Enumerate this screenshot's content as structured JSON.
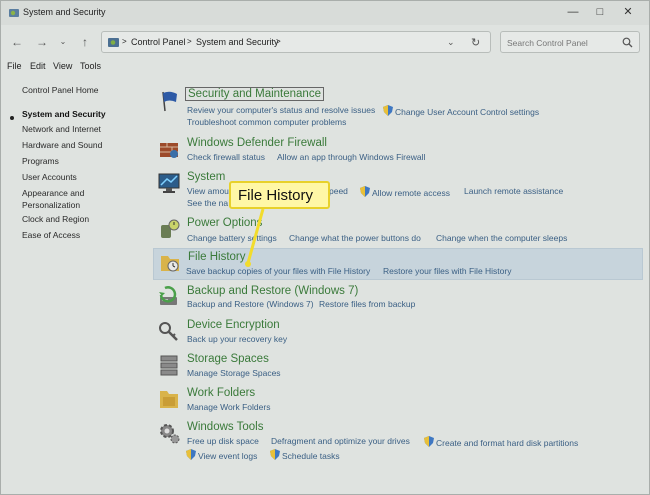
{
  "window": {
    "title": "System and Security"
  },
  "address": {
    "crumbs": [
      "Control Panel",
      "System and Security"
    ],
    "separator": ">",
    "search_placeholder": "Search Control Panel"
  },
  "menu": [
    "File",
    "Edit",
    "View",
    "Tools"
  ],
  "sidebar": {
    "items": [
      {
        "label": "Control Panel Home"
      },
      {
        "label": "System and Security"
      },
      {
        "label": "Network and Internet"
      },
      {
        "label": "Hardware and Sound"
      },
      {
        "label": "Programs"
      },
      {
        "label": "User Accounts"
      },
      {
        "label": "Appearance and Personalization"
      },
      {
        "label": "Clock and Region"
      },
      {
        "label": "Ease of Access"
      }
    ]
  },
  "categories": [
    {
      "title": "Security and Maintenance",
      "icon": "security-flag-icon",
      "links": [
        "Review your computer's status and resolve issues",
        "Change User Account Control settings",
        "Troubleshoot common computer problems"
      ]
    },
    {
      "title": "Windows Defender Firewall",
      "icon": "firewall-icon",
      "links": [
        "Check firewall status",
        "Allow an app through Windows Firewall"
      ]
    },
    {
      "title": "System",
      "icon": "monitor-icon",
      "links": [
        "View amou",
        "peed",
        "Allow remote access",
        "Launch remote assistance",
        "See the na"
      ]
    },
    {
      "title": "Power Options",
      "icon": "power-plug-icon",
      "links": [
        "Change battery settings",
        "Change what the power buttons do",
        "Change when the computer sleeps"
      ]
    },
    {
      "title": "File History",
      "icon": "file-history-icon",
      "links": [
        "Save backup copies of your files with File History",
        "Restore your files with File History"
      ]
    },
    {
      "title": "Backup and Restore (Windows 7)",
      "icon": "backup-icon",
      "links": [
        "Backup and Restore (Windows 7)",
        "Restore files from backup"
      ]
    },
    {
      "title": "Device Encryption",
      "icon": "key-icon",
      "links": [
        "Back up your recovery key"
      ]
    },
    {
      "title": "Storage Spaces",
      "icon": "storage-icon",
      "links": [
        "Manage Storage Spaces"
      ]
    },
    {
      "title": "Work Folders",
      "icon": "folder-icon",
      "links": [
        "Manage Work Folders"
      ]
    },
    {
      "title": "Windows Tools",
      "icon": "tools-gear-icon",
      "links": [
        "Free up disk space",
        "Defragment and optimize your drives",
        "Create and format hard disk partitions",
        "View event logs",
        "Schedule tasks"
      ]
    }
  ],
  "callout": {
    "text": "File History"
  },
  "colors": {
    "link": "#3a5f84",
    "title_green": "#3a7a3a",
    "callout_bg": "#fff7a6",
    "callout_border": "#e8d12a",
    "highlight": "#c7d4dc"
  }
}
